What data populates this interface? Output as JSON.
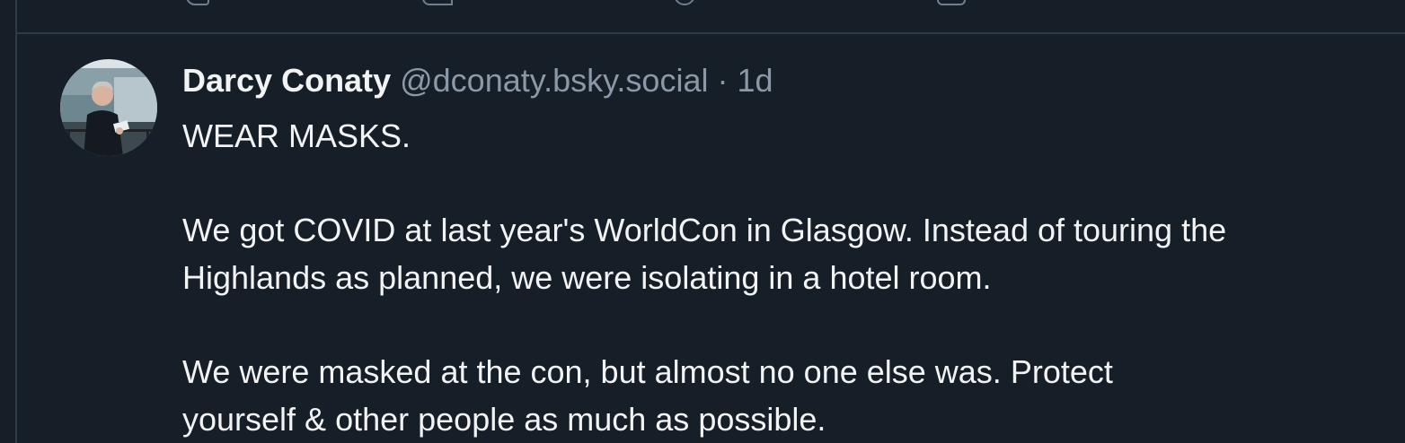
{
  "post": {
    "author_name": "Darcy Conaty",
    "author_handle": "@dconaty.bsky.social",
    "separator": "·",
    "timestamp": "1d",
    "paragraphs": [
      [
        "WEAR MASKS."
      ],
      [
        "We got COVID at last year's WorldCon in Glasgow. Instead of touring the",
        "Highlands as planned, we were isolating in a hotel room."
      ],
      [
        "We were masked at the con, but almost no one else was. Protect",
        "yourself & other people as much as possible."
      ]
    ]
  },
  "previous_post_actions": {
    "icons": [
      "reply-icon",
      "repost-icon",
      "like-icon",
      "more-icon"
    ]
  },
  "colors": {
    "background": "#161e27",
    "border": "#2e3a48",
    "text_primary": "#f1f3f5",
    "text_secondary": "#8b98a8"
  }
}
